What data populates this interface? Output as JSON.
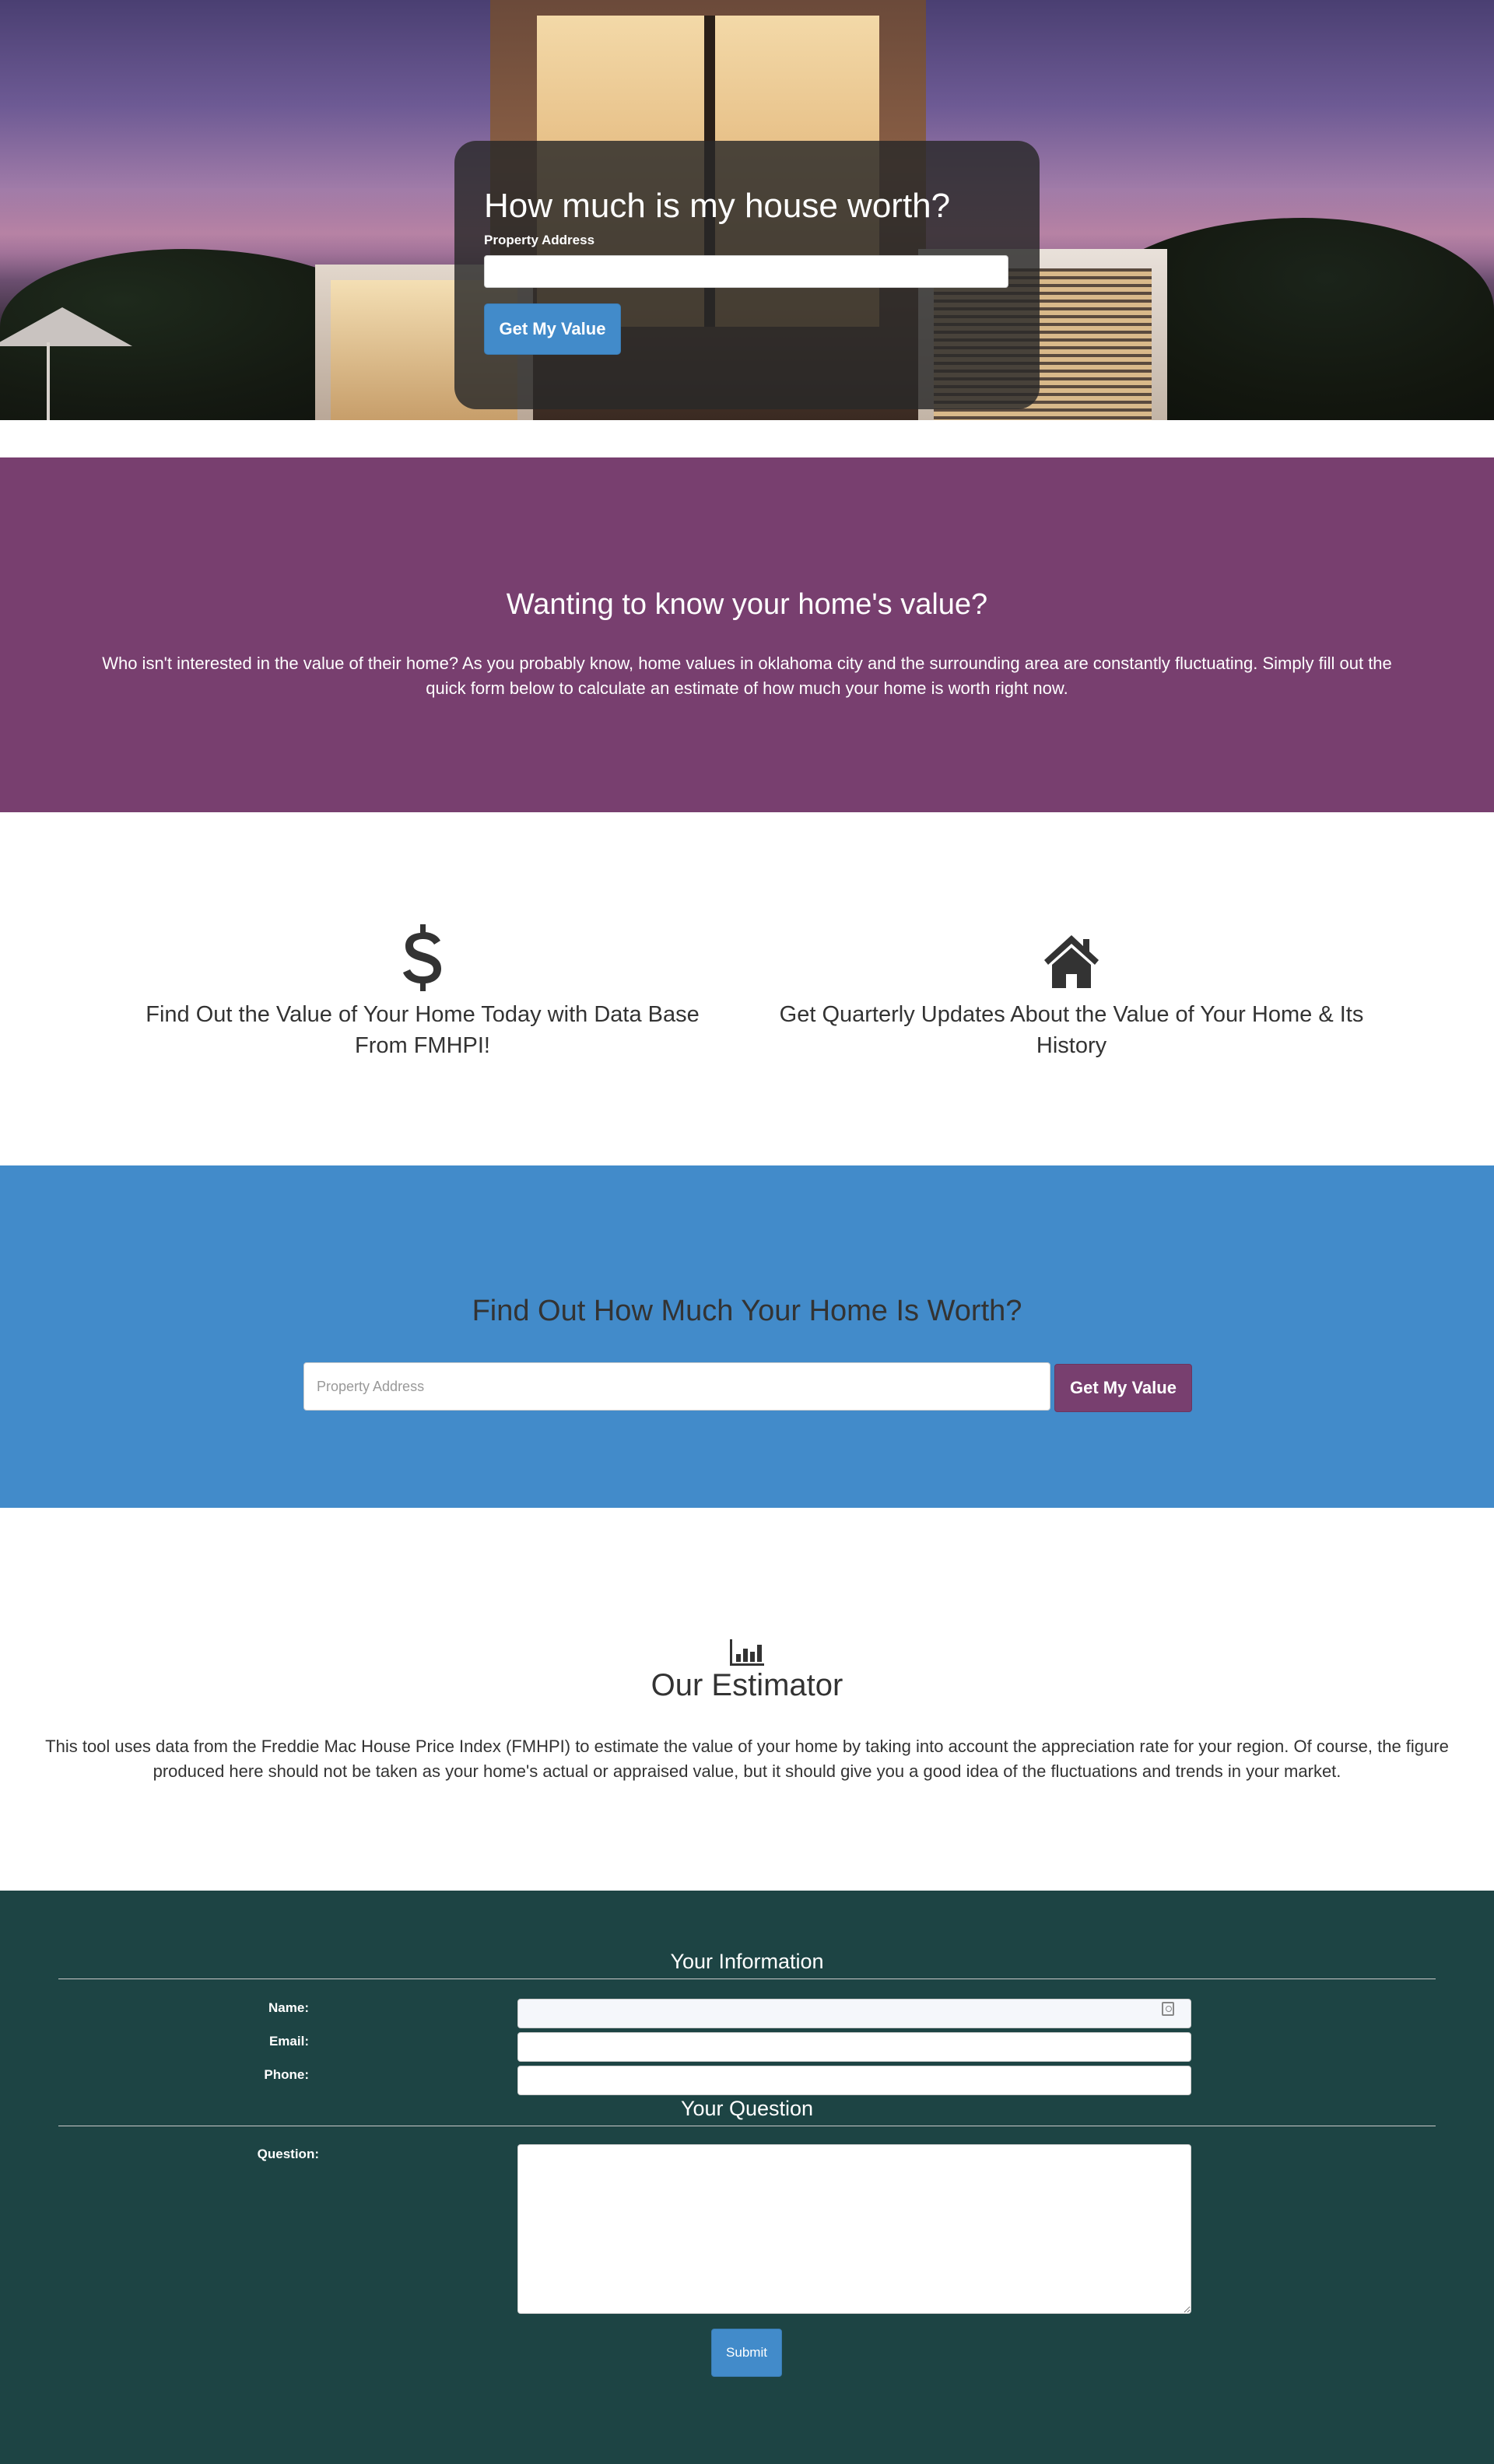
{
  "hero": {
    "title": "How much is my house worth?",
    "address_label": "Property Address",
    "address_value": "",
    "button_label": "Get My Value"
  },
  "intro": {
    "heading": "Wanting to know your home's value?",
    "body": "Who isn't interested in the value of their home? As you probably know, home values in oklahoma city and the surrounding area are constantly fluctuating. Simply fill out the quick form below to calculate an estimate of how much your home is worth right now."
  },
  "features": [
    {
      "icon": "dollar-icon",
      "text": "Find Out the Value of Your Home Today with Data Base From FMHPI!"
    },
    {
      "icon": "home-icon",
      "text": "Get Quarterly Updates About the Value of Your Home & Its History"
    }
  ],
  "cta": {
    "heading": "Find Out How Much Your Home Is Worth?",
    "placeholder": "Property Address",
    "button_label": "Get My Value"
  },
  "estimator": {
    "icon": "bar-chart-icon",
    "heading": "Our Estimator",
    "body": "This tool uses data from the Freddie Mac House Price Index (FMHPI) to estimate the value of your home by taking into account the appreciation rate for your region. Of course, the figure produced here should not be taken as your home's actual or appraised value, but it should give you a good idea of the fluctuations and trends in your market."
  },
  "contact_form": {
    "info_legend": "Your Information",
    "name_label": "Name:",
    "email_label": "Email:",
    "phone_label": "Phone:",
    "question_legend": "Your Question",
    "question_label": "Question:",
    "submit_label": "Submit"
  },
  "colors": {
    "purple": "#783f6f",
    "blue": "#428bca",
    "dark_teal": "#1d4444"
  }
}
